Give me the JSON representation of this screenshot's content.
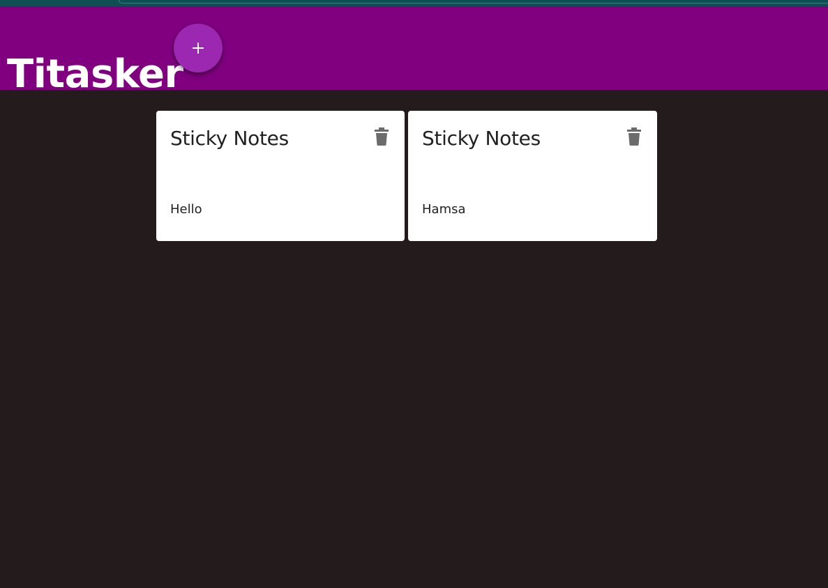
{
  "app": {
    "title": "Titasker",
    "add_button": {
      "icon": "plus-icon"
    }
  },
  "colors": {
    "app_bar": "#800080",
    "add_button": "#9c27b0",
    "background": "#241c1c",
    "card": "#ffffff",
    "icon": "#6b6b6b"
  },
  "notes": [
    {
      "title": "Sticky Notes",
      "content": "Hello",
      "delete_icon": "trash-icon"
    },
    {
      "title": "Sticky Notes",
      "content": "Hamsa",
      "delete_icon": "trash-icon"
    }
  ]
}
